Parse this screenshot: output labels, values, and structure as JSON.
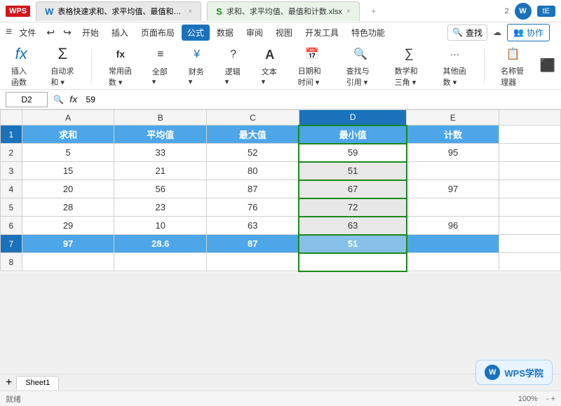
{
  "titleBar": {
    "wpsLabel": "WPS",
    "tab1Label": "表格快速求和、求平均值、最值和计数 …",
    "tab2Label": "求和、求平均值、最值和计数.xlsx",
    "closeSymbol": "×",
    "addSymbol": "+",
    "userBadge": "tE",
    "menuItems": [
      "文件",
      "开始",
      "插入",
      "页面布局",
      "公式",
      "数据",
      "审阅",
      "视图",
      "开发工具",
      "特色功能"
    ],
    "activeMenu": "公式",
    "searchPlaceholder": "查找",
    "collabLabel": "协作"
  },
  "ribbon": {
    "buttons": [
      {
        "label": "插入函数",
        "icon": "𝑓"
      },
      {
        "label": "自动求和",
        "icon": "Σ"
      },
      {
        "label": "常用函数",
        "icon": "fx"
      },
      {
        "label": "全部",
        "icon": "≡"
      },
      {
        "label": "财务",
        "icon": "¥"
      },
      {
        "label": "逻辑",
        "icon": "?"
      },
      {
        "label": "文本",
        "icon": "A"
      },
      {
        "label": "日期和时间",
        "icon": "📅"
      },
      {
        "label": "查找与引用",
        "icon": "🔍"
      },
      {
        "label": "数学和三角",
        "icon": "∑"
      },
      {
        "label": "其他函数",
        "icon": "···"
      },
      {
        "label": "名称管理器",
        "icon": "📋"
      }
    ]
  },
  "formulaBar": {
    "cellRef": "D2",
    "formula": "59"
  },
  "columns": {
    "headers": [
      "",
      "A",
      "B",
      "C",
      "D",
      "E"
    ],
    "widths": [
      28,
      120,
      120,
      120,
      140,
      120
    ]
  },
  "rows": [
    {
      "rowNum": "1",
      "isHeader": true,
      "cells": [
        {
          "col": "A",
          "value": "求和",
          "type": "blue"
        },
        {
          "col": "B",
          "value": "平均值",
          "type": "blue"
        },
        {
          "col": "C",
          "value": "最大值",
          "type": "blue"
        },
        {
          "col": "D",
          "value": "最小值",
          "type": "blue"
        },
        {
          "col": "E",
          "value": "计数",
          "type": "blue"
        }
      ]
    },
    {
      "rowNum": "2",
      "cells": [
        {
          "col": "A",
          "value": "5",
          "type": "white"
        },
        {
          "col": "B",
          "value": "33",
          "type": "white"
        },
        {
          "col": "C",
          "value": "52",
          "type": "white"
        },
        {
          "col": "D",
          "value": "59",
          "type": "d-selected"
        },
        {
          "col": "E",
          "value": "95",
          "type": "white"
        }
      ]
    },
    {
      "rowNum": "3",
      "cells": [
        {
          "col": "A",
          "value": "15",
          "type": "white"
        },
        {
          "col": "B",
          "value": "21",
          "type": "white"
        },
        {
          "col": "C",
          "value": "80",
          "type": "white"
        },
        {
          "col": "D",
          "value": "51",
          "type": "d-gray"
        },
        {
          "col": "E",
          "value": "",
          "type": "white"
        }
      ]
    },
    {
      "rowNum": "4",
      "cells": [
        {
          "col": "A",
          "value": "20",
          "type": "white"
        },
        {
          "col": "B",
          "value": "56",
          "type": "white"
        },
        {
          "col": "C",
          "value": "87",
          "type": "white"
        },
        {
          "col": "D",
          "value": "67",
          "type": "d-gray"
        },
        {
          "col": "E",
          "value": "97",
          "type": "white"
        }
      ]
    },
    {
      "rowNum": "5",
      "cells": [
        {
          "col": "A",
          "value": "28",
          "type": "white"
        },
        {
          "col": "B",
          "value": "23",
          "type": "white"
        },
        {
          "col": "C",
          "value": "76",
          "type": "white"
        },
        {
          "col": "D",
          "value": "72",
          "type": "d-gray"
        },
        {
          "col": "E",
          "value": "",
          "type": "white"
        }
      ]
    },
    {
      "rowNum": "6",
      "cells": [
        {
          "col": "A",
          "value": "29",
          "type": "white"
        },
        {
          "col": "B",
          "value": "10",
          "type": "white"
        },
        {
          "col": "C",
          "value": "63",
          "type": "white"
        },
        {
          "col": "D",
          "value": "63",
          "type": "d-gray"
        },
        {
          "col": "E",
          "value": "96",
          "type": "white"
        }
      ]
    },
    {
      "rowNum": "7",
      "cells": [
        {
          "col": "A",
          "value": "97",
          "type": "blue"
        },
        {
          "col": "B",
          "value": "28.6",
          "type": "blue"
        },
        {
          "col": "C",
          "value": "87",
          "type": "blue"
        },
        {
          "col": "D",
          "value": "51",
          "type": "d-blue"
        },
        {
          "col": "E",
          "value": "",
          "type": "blue"
        }
      ]
    },
    {
      "rowNum": "8",
      "cells": [
        {
          "col": "A",
          "value": "",
          "type": "white"
        },
        {
          "col": "B",
          "value": "",
          "type": "white"
        },
        {
          "col": "C",
          "value": "",
          "type": "white"
        },
        {
          "col": "D",
          "value": "",
          "type": "white"
        },
        {
          "col": "E",
          "value": "",
          "type": "white"
        }
      ]
    }
  ],
  "sheetTab": "Sheet1",
  "wpsAcademy": "WPS学院"
}
